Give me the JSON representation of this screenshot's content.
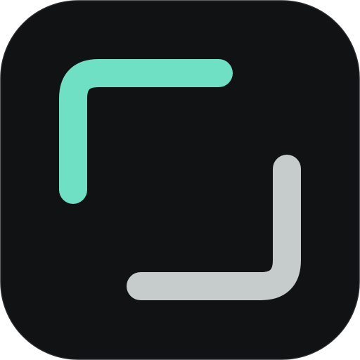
{
  "icon": {
    "name": "app-icon",
    "shape": "rounded-square",
    "background_color": "#111214",
    "border_color": "#2a2b2e",
    "glyphs": [
      {
        "name": "top-left-corner-bracket-icon",
        "color": "#6FE0C3"
      },
      {
        "name": "bottom-right-corner-bracket-icon",
        "color": "#C6CBCB"
      }
    ]
  }
}
